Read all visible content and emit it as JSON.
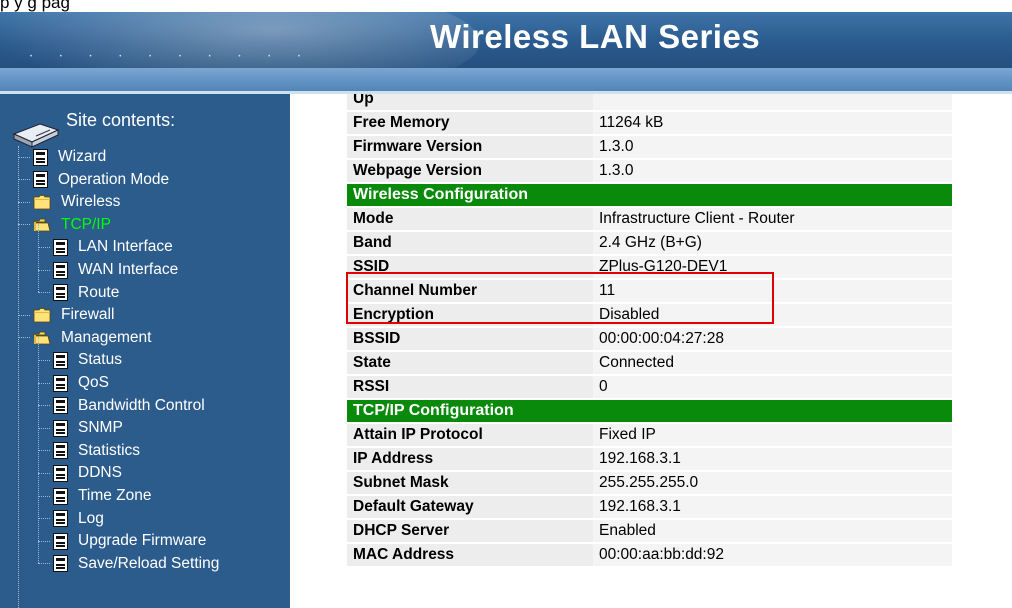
{
  "top_strip": {
    "text": "p              y                                                                 g                                    pag"
  },
  "banner": {
    "title": "Wireless LAN Series"
  },
  "sidebar": {
    "heading": "Site contents:",
    "items": [
      {
        "label": "Wizard",
        "icon": "document-icon",
        "level": 1
      },
      {
        "label": "Operation Mode",
        "icon": "document-icon",
        "level": 1
      },
      {
        "label": "Wireless",
        "icon": "folder-closed-icon",
        "level": 1
      },
      {
        "label": "TCP/IP",
        "icon": "folder-open-icon",
        "level": 1,
        "active": true
      },
      {
        "label": "LAN Interface",
        "icon": "document-icon",
        "level": 2
      },
      {
        "label": "WAN Interface",
        "icon": "document-icon",
        "level": 2
      },
      {
        "label": "Route",
        "icon": "document-icon",
        "level": 2
      },
      {
        "label": "Firewall",
        "icon": "folder-closed-icon",
        "level": 1
      },
      {
        "label": "Management",
        "icon": "folder-open-icon",
        "level": 1
      },
      {
        "label": "Status",
        "icon": "document-icon",
        "level": 2
      },
      {
        "label": "QoS",
        "icon": "document-icon",
        "level": 2
      },
      {
        "label": "Bandwidth Control",
        "icon": "document-icon",
        "level": 2
      },
      {
        "label": "SNMP",
        "icon": "document-icon",
        "level": 2
      },
      {
        "label": "Statistics",
        "icon": "document-icon",
        "level": 2
      },
      {
        "label": "DDNS",
        "icon": "document-icon",
        "level": 2
      },
      {
        "label": "Time Zone",
        "icon": "document-icon",
        "level": 2
      },
      {
        "label": "Log",
        "icon": "document-icon",
        "level": 2
      },
      {
        "label": "Upgrade Firmware",
        "icon": "document-icon",
        "level": 2
      },
      {
        "label": "Save/Reload Setting",
        "icon": "document-icon",
        "level": 2
      }
    ]
  },
  "status": {
    "rows": [
      {
        "type": "row",
        "key": "Up",
        "value": ""
      },
      {
        "type": "row",
        "key": "Free Memory",
        "value": "11264 kB"
      },
      {
        "type": "row",
        "key": "Firmware Version",
        "value": "1.3.0"
      },
      {
        "type": "row",
        "key": "Webpage Version",
        "value": "1.3.0"
      },
      {
        "type": "section",
        "key": "Wireless Configuration"
      },
      {
        "type": "row",
        "key": "Mode",
        "value": "Infrastructure Client - Router"
      },
      {
        "type": "row",
        "key": "Band",
        "value": "2.4 GHz (B+G)"
      },
      {
        "type": "row",
        "key": "SSID",
        "value": "ZPlus-G120-DEV1"
      },
      {
        "type": "row",
        "key": "Channel Number",
        "value": "11"
      },
      {
        "type": "row",
        "key": "Encryption",
        "value": "Disabled"
      },
      {
        "type": "row",
        "key": "BSSID",
        "value": "00:00:00:04:27:28"
      },
      {
        "type": "row",
        "key": "State",
        "value": "Connected"
      },
      {
        "type": "row",
        "key": "RSSI",
        "value": "0"
      },
      {
        "type": "section",
        "key": "TCP/IP Configuration"
      },
      {
        "type": "row",
        "key": "Attain IP Protocol",
        "value": "Fixed IP"
      },
      {
        "type": "row",
        "key": "IP Address",
        "value": "192.168.3.1"
      },
      {
        "type": "row",
        "key": "Subnet Mask",
        "value": "255.255.255.0"
      },
      {
        "type": "row",
        "key": "Default Gateway",
        "value": "192.168.3.1"
      },
      {
        "type": "row",
        "key": "DHCP Server",
        "value": "Enabled"
      },
      {
        "type": "row",
        "key": "MAC Address",
        "value": "00:00:aa:bb:dd:92"
      }
    ]
  },
  "colors": {
    "sidebar_bg": "#2c5c8c",
    "section_green": "#0a8a0a",
    "active_item": "#00ff00",
    "highlight_box": "#e00000"
  }
}
